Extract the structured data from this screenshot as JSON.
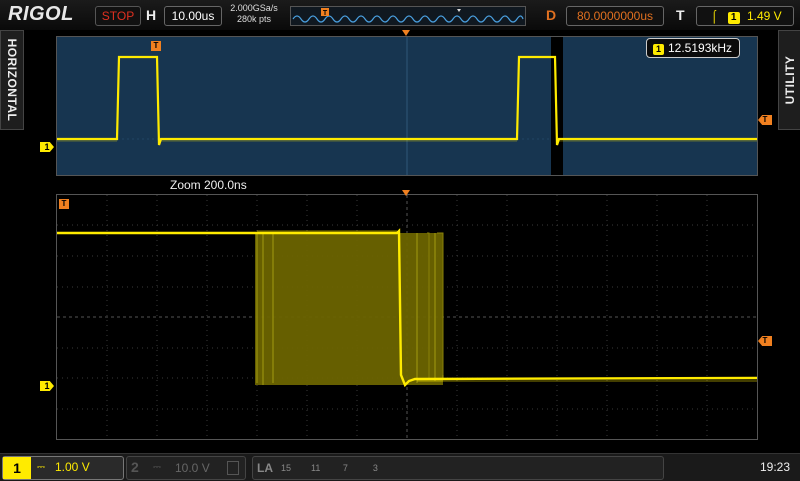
{
  "brand": "RIGOL",
  "header": {
    "run_status": "STOP",
    "h_label": "H",
    "timebase": "10.00us",
    "sample_rate": "2.000GSa/s",
    "memory_depth": "280k pts",
    "d_label": "D",
    "delay": "80.0000000us",
    "t_label": "T",
    "trigger_channel": "1",
    "trigger_level": "1.49 V"
  },
  "side_tabs": {
    "left": "HORIZONTAL",
    "right": "UTILITY"
  },
  "overview": {
    "frequency": "12.5193kHz"
  },
  "zoom": {
    "label": "Zoom  200.0ns"
  },
  "channels": {
    "ch1": {
      "number": "1",
      "scale": "1.00 V",
      "color": "#ffeb00"
    },
    "ch2": {
      "number": "2",
      "scale": "10.0 V"
    }
  },
  "logic_analyzer": {
    "label": "LA",
    "digits": "15        11         7          3"
  },
  "clock": "19:23",
  "colors": {
    "trace": "#ffeb00",
    "trigger": "#f08020",
    "overview_bg": "#173550",
    "stop": "#e03020"
  }
}
